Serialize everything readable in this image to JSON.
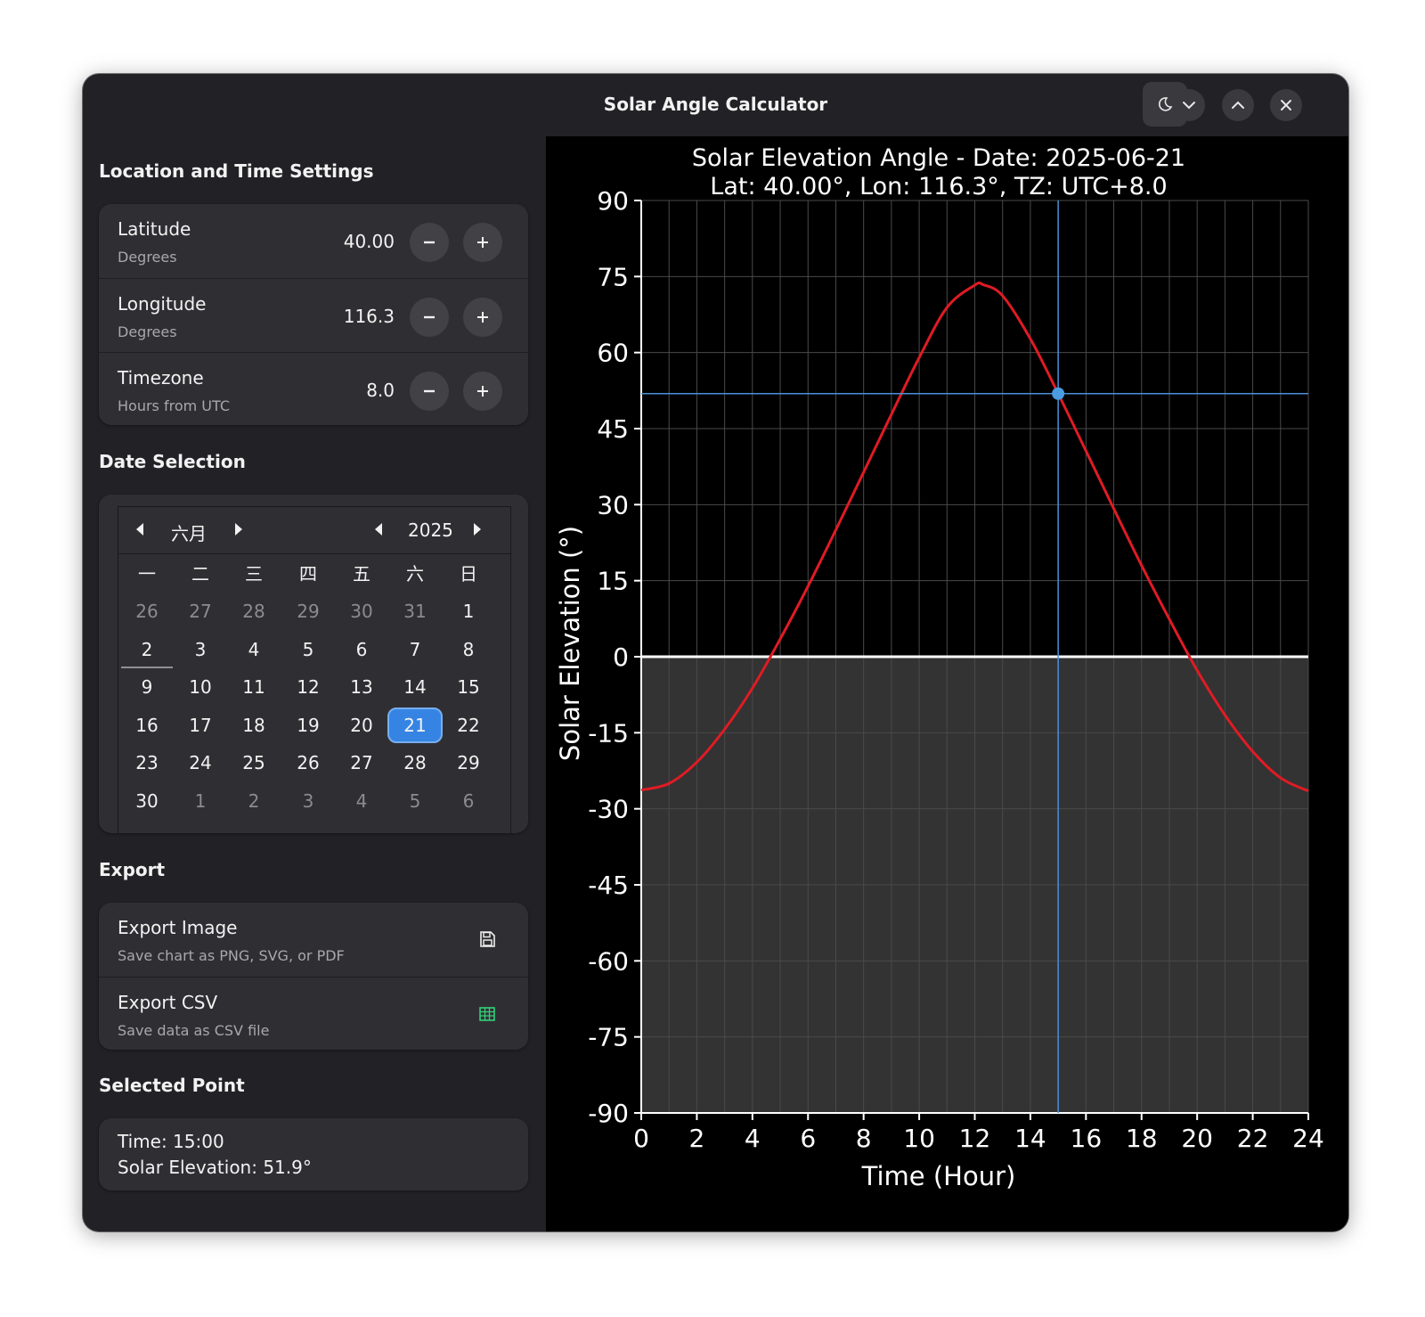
{
  "window": {
    "title": "Solar Angle Calculator"
  },
  "sections": {
    "location": "Location and Time Settings",
    "date": "Date Selection",
    "export": "Export",
    "selected": "Selected Point"
  },
  "settings": [
    {
      "label": "Latitude",
      "sub": "Degrees",
      "value": "40.00"
    },
    {
      "label": "Longitude",
      "sub": "Degrees",
      "value": "116.3"
    },
    {
      "label": "Timezone",
      "sub": "Hours from UTC",
      "value": "8.0"
    }
  ],
  "calendar": {
    "month": "六月",
    "year": "2025",
    "weekdays": [
      "一",
      "二",
      "三",
      "四",
      "五",
      "六",
      "日"
    ],
    "days": [
      [
        "26",
        "27",
        "28",
        "29",
        "30",
        "31",
        "1"
      ],
      [
        "2",
        "3",
        "4",
        "5",
        "6",
        "7",
        "8"
      ],
      [
        "9",
        "10",
        "11",
        "12",
        "13",
        "14",
        "15"
      ],
      [
        "16",
        "17",
        "18",
        "19",
        "20",
        "21",
        "22"
      ],
      [
        "23",
        "24",
        "25",
        "26",
        "27",
        "28",
        "29"
      ],
      [
        "30",
        "1",
        "2",
        "3",
        "4",
        "5",
        "6"
      ]
    ],
    "selected_day": "21",
    "today_day": "2"
  },
  "export": {
    "image": {
      "label": "Export Image",
      "sub": "Save chart as PNG, SVG, or PDF"
    },
    "csv": {
      "label": "Export CSV",
      "sub": "Save data as CSV file"
    }
  },
  "selected_point": {
    "time": "Time: 15:00",
    "elevation": "Solar Elevation: 51.9°"
  },
  "colors": {
    "accent": "#3584e4",
    "curve": "#e01b24",
    "csv_icon": "#33d17a",
    "crosshair": "#4a90d9"
  },
  "chart_data": {
    "type": "line",
    "title": "Solar Elevation Angle - Date: 2025-06-21",
    "subtitle": "Lat: 40.00°, Lon: 116.3°, TZ: UTC+8.0",
    "xlabel": "Time (Hour)",
    "ylabel": "Solar Elevation (°)",
    "xlim": [
      0,
      24
    ],
    "ylim": [
      -90,
      90
    ],
    "xticks": [
      0,
      2,
      4,
      6,
      8,
      10,
      12,
      14,
      16,
      18,
      20,
      22,
      24
    ],
    "yticks": [
      90,
      75,
      60,
      45,
      30,
      15,
      0,
      -15,
      -30,
      -45,
      -60,
      -75,
      -90
    ],
    "grid": true,
    "series": [
      {
        "x": [
          0,
          1,
          2,
          3,
          4,
          5,
          6,
          7,
          8,
          9,
          10,
          11,
          12,
          12.3,
          13,
          14,
          15,
          16,
          17,
          18,
          19,
          20,
          21,
          22,
          23,
          24
        ],
        "y": [
          -26.3,
          -25.0,
          -20.8,
          -14.3,
          -6.2,
          3.5,
          13.9,
          25.0,
          36.4,
          47.8,
          59.0,
          68.9,
          73.3,
          73.4,
          71.2,
          62.7,
          51.9,
          40.6,
          29.2,
          18.0,
          7.4,
          -2.7,
          -11.5,
          -18.7,
          -23.9,
          -26.5
        ]
      }
    ],
    "selected_point": {
      "x": 15,
      "y": 51.9
    }
  }
}
